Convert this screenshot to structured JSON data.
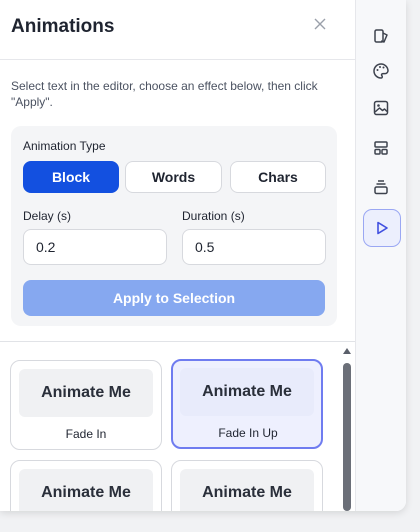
{
  "panel": {
    "title": "Animations",
    "help_text": "Select text in the editor, choose an effect below, then click \"Apply\".",
    "animation_type_label": "Animation Type",
    "types": [
      {
        "label": "Block",
        "selected": true
      },
      {
        "label": "Words",
        "selected": false
      },
      {
        "label": "Chars",
        "selected": false
      }
    ],
    "delay": {
      "label": "Delay (s)",
      "value": "0.2"
    },
    "duration": {
      "label": "Duration (s)",
      "value": "0.5"
    },
    "apply_label": "Apply to Selection"
  },
  "effects": [
    {
      "preview": "Animate Me",
      "name": "Fade In",
      "selected": false
    },
    {
      "preview": "Animate Me",
      "name": "Fade In Up",
      "selected": true
    },
    {
      "preview": "Animate Me",
      "name": "",
      "selected": false
    },
    {
      "preview": "Animate Me",
      "name": "",
      "selected": false
    }
  ],
  "sidebar": {
    "icons": [
      "layers-icon",
      "palette-icon",
      "image-icon",
      "layout-icon",
      "stack-icon",
      "play-icon"
    ],
    "active": "play-icon"
  },
  "colors": {
    "accent": "#1350e0",
    "apply_disabled": "#86a8f0",
    "selected_border": "#6f7cf0"
  }
}
